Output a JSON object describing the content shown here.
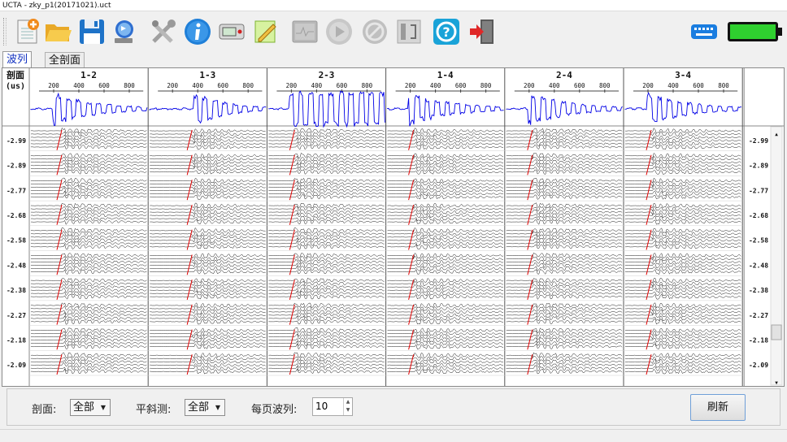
{
  "window": {
    "title": "UCTA - zky_p1(20171021).uct"
  },
  "toolbar": {
    "buttons": [
      {
        "name": "new-file-icon"
      },
      {
        "name": "open-folder-icon"
      },
      {
        "name": "save-icon"
      },
      {
        "name": "usb-export-icon"
      },
      {
        "name": "tools-icon"
      },
      {
        "name": "info-icon"
      },
      {
        "name": "device-icon"
      },
      {
        "name": "edit-notes-icon"
      },
      {
        "name": "oscilloscope-icon"
      },
      {
        "name": "play-icon"
      },
      {
        "name": "stop-icon"
      },
      {
        "name": "connection-icon"
      },
      {
        "name": "help-icon"
      },
      {
        "name": "exit-icon"
      }
    ],
    "right_icons": [
      {
        "name": "keyboard-icon"
      },
      {
        "name": "battery-icon"
      }
    ],
    "battery_level": 1.0
  },
  "tabs": [
    {
      "label": "波列",
      "active": true
    },
    {
      "label": "全剖面",
      "active": false
    }
  ],
  "plot": {
    "corner_label_line1": "剖面",
    "corner_label_line2": "(us)",
    "sections": [
      "1-2",
      "1-3",
      "2-3",
      "1-4",
      "2-4",
      "3-4"
    ],
    "tick_labels": [
      "200",
      "400",
      "600",
      "800"
    ],
    "depth_labels": [
      "-2.99",
      "-2.89",
      "-2.77",
      "-2.68",
      "-2.58",
      "-2.48",
      "-2.38",
      "-2.27",
      "-2.18",
      "-2.09"
    ],
    "colors": {
      "summary_wave": "#0000e6",
      "trace": "#000000",
      "pick": "#e00000",
      "grid": "#d0d0d0"
    }
  },
  "controls": {
    "section_label": "剖面:",
    "section_value": "全部",
    "oblique_label": "平斜测:",
    "oblique_value": "全部",
    "per_page_label": "每页波列:",
    "per_page_value": "10",
    "refresh_label": "刷新"
  }
}
